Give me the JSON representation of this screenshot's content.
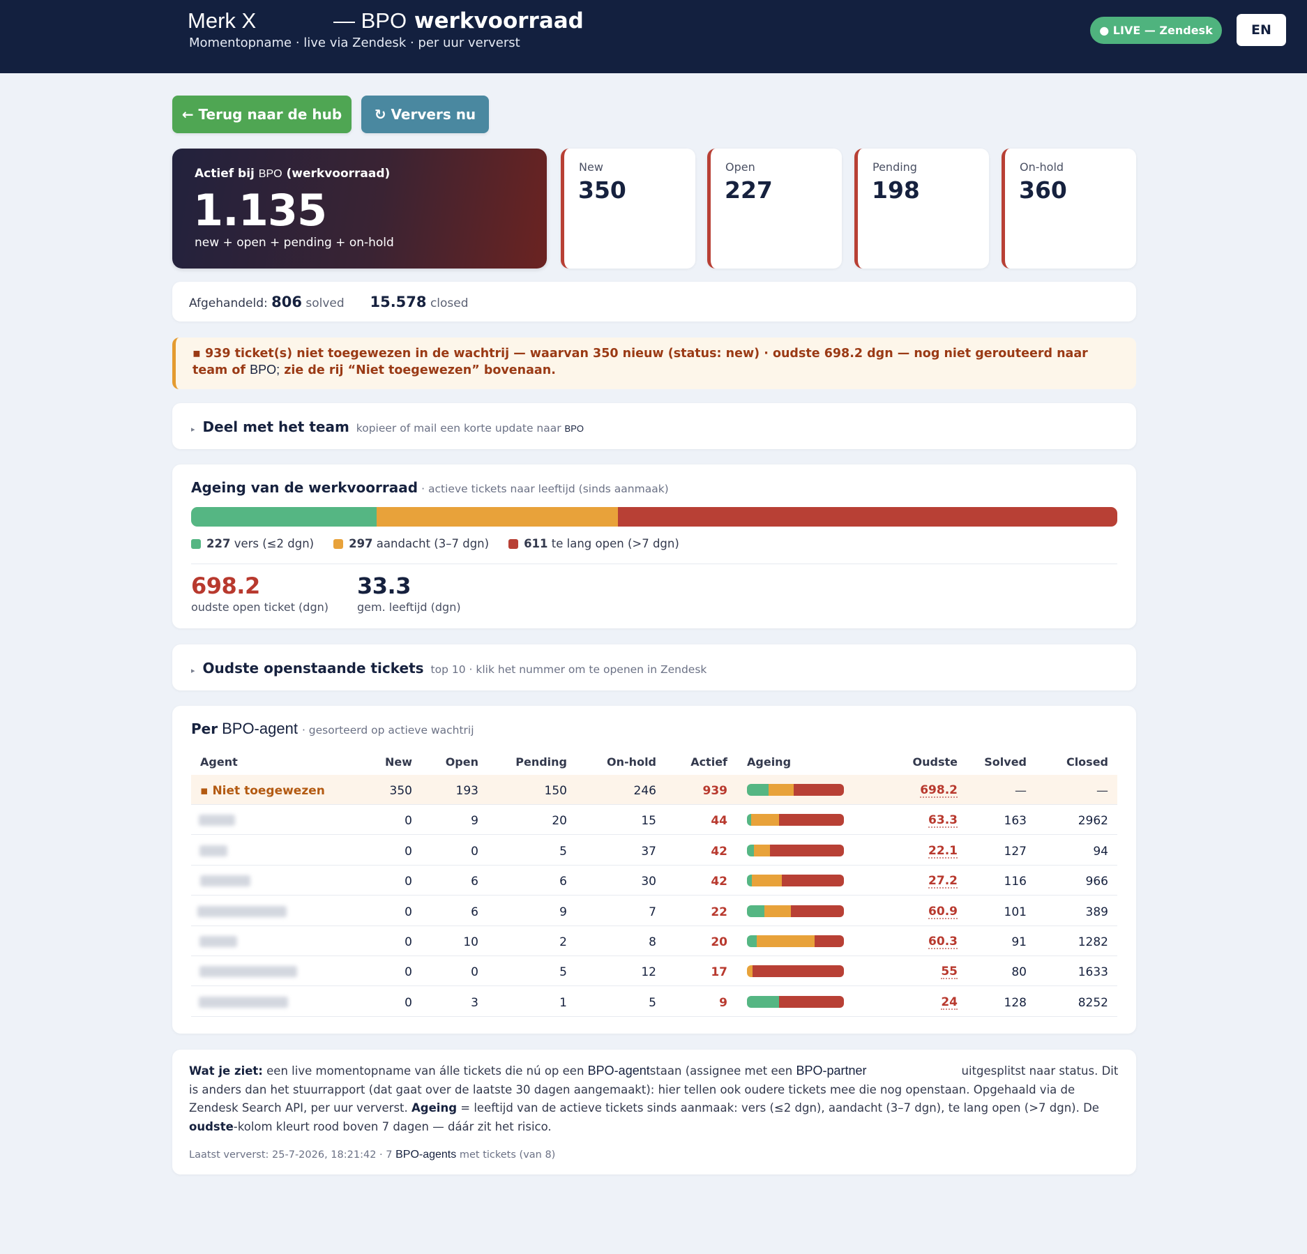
{
  "header": {
    "brand": "Merk X",
    "title_sep": "— BPO",
    "title_main": "werkvoorraad",
    "subtitle": "Momentopname · live via Zendesk · per uur ververst",
    "live_badge": "● LIVE — Zendesk",
    "lang_button": "EN"
  },
  "actions": {
    "back_label": "← Terug naar de hub",
    "refresh_label": "↻ Ververs nu"
  },
  "hero": {
    "label_pre": "Actief bij",
    "label_bpo": "BPO",
    "label_post": "(werkvoorraad)",
    "value": "1.135",
    "formula": "new + open + pending + on-hold"
  },
  "status_cards": [
    {
      "label": "New",
      "value": "350"
    },
    {
      "label": "Open",
      "value": "227"
    },
    {
      "label": "Pending",
      "value": "198"
    },
    {
      "label": "On-hold",
      "value": "360"
    }
  ],
  "resolved": {
    "label": "Afgehandeld:",
    "solved_value": "806",
    "solved_label": "solved",
    "closed_value": "15.578",
    "closed_label": "closed"
  },
  "alert": {
    "bullet": "▪",
    "count": "939",
    "t1": "ticket(s) niet toegewezen in de wachtrij — waarvan",
    "new_count": "350",
    "t2": "nieuw (status: new) · oudste",
    "oldest": "698.2",
    "t3": "dgn — nog niet gerouteerd naar team of",
    "bpo": "BPO;",
    "t4": "zie de rij “Niet toegewezen” bovenaan."
  },
  "share": {
    "caret": "▸",
    "title": "Deel met het team",
    "subtitle": "kopieer of mail een korte update naar",
    "bpo": "BPO"
  },
  "ageing": {
    "title": "Ageing van de werkvoorraad",
    "subtitle": "· actieve tickets naar leeftijd (sinds aanmaak)",
    "segments": [
      {
        "count": "227",
        "label": "vers (≤2 dgn)",
        "share": 0.2
      },
      {
        "count": "297",
        "label": "aandacht (3–7 dgn)",
        "share": 0.261
      },
      {
        "count": "611",
        "label": "te lang open (>7 dgn)",
        "share": 0.539
      }
    ],
    "oldest_value": "698.2",
    "oldest_label": "oudste open ticket (dgn)",
    "avg_value": "33.3",
    "avg_label": "gem. leeftijd (dgn)"
  },
  "oldest_tickets": {
    "caret": "▸",
    "title": "Oudste openstaande tickets",
    "subtitle": "top 10 · klik het nummer om te openen in Zendesk"
  },
  "agents": {
    "title_pre": "Per",
    "title_token": "BPO-agent",
    "subtitle": "· gesorteerd op actieve wachtrij",
    "columns": [
      "Agent",
      "New",
      "Open",
      "Pending",
      "On-hold",
      "Actief",
      "Ageing",
      "Oudste",
      "Solved",
      "Closed"
    ],
    "rows": [
      {
        "name": "▪ Niet toegewezen",
        "new": "350",
        "open": "193",
        "pending": "150",
        "onhold": "246",
        "active": "939",
        "ageing": [
          0.22,
          0.26,
          0.52
        ],
        "oldest": "698.2",
        "solved": "—",
        "closed": "—"
      },
      {
        "new": "0",
        "open": "9",
        "pending": "20",
        "onhold": "15",
        "active": "44",
        "ageing": [
          0.04,
          0.29,
          0.67
        ],
        "oldest": "63.3",
        "solved": "163",
        "closed": "2962"
      },
      {
        "new": "0",
        "open": "0",
        "pending": "5",
        "onhold": "37",
        "active": "42",
        "ageing": [
          0.07,
          0.17,
          0.76
        ],
        "oldest": "22.1",
        "solved": "127",
        "closed": "94"
      },
      {
        "new": "0",
        "open": "6",
        "pending": "6",
        "onhold": "30",
        "active": "42",
        "ageing": [
          0.05,
          0.31,
          0.64
        ],
        "oldest": "27.2",
        "solved": "116",
        "closed": "966"
      },
      {
        "new": "0",
        "open": "6",
        "pending": "9",
        "onhold": "7",
        "active": "22",
        "ageing": [
          0.18,
          0.27,
          0.55
        ],
        "oldest": "60.9",
        "solved": "101",
        "closed": "389"
      },
      {
        "new": "0",
        "open": "10",
        "pending": "2",
        "onhold": "8",
        "active": "20",
        "ageing": [
          0.1,
          0.6,
          0.3
        ],
        "oldest": "60.3",
        "solved": "91",
        "closed": "1282"
      },
      {
        "new": "0",
        "open": "0",
        "pending": "5",
        "onhold": "12",
        "active": "17",
        "ageing": [
          0.0,
          0.06,
          0.94
        ],
        "oldest": "55",
        "solved": "80",
        "closed": "1633"
      },
      {
        "new": "0",
        "open": "3",
        "pending": "1",
        "onhold": "5",
        "active": "9",
        "ageing": [
          0.33,
          0.0,
          0.67
        ],
        "oldest": "24",
        "solved": "128",
        "closed": "8252"
      }
    ]
  },
  "footnote": {
    "bold1": "Wat je ziet:",
    "t1": "een live momentopname van álle tickets die nú op een",
    "tok1": "BPO-agent",
    "t2": "staan (assignee met een",
    "tok2": "BPO-partner",
    "t3": "uitgesplitst naar status. Dit is anders dan het stuurrapport (dat gaat over de laatste 30 dagen aangemaakt): hier tellen ook oudere tickets mee die nog openstaan. Opgehaald via de Zendesk Search API, per uur ververst.",
    "bold2": "Ageing",
    "t4": "= leeftijd van de actieve tickets sinds aanmaak: vers (≤2 dgn), aandacht (3–7 dgn), te lang open (>7 dgn). De",
    "bold3": "oudste",
    "t5": "-kolom kleurt rood boven 7 dagen — dáár zit het risico.",
    "meta_pre": "Laatst ververst: 25-7-2026, 18:21:42 · 7",
    "meta_tok": "BPO-agents",
    "meta_post": "met tickets (van 8)"
  },
  "colors": {
    "fresh": "#55b683",
    "attention": "#e8a23a",
    "late": "#b84035"
  }
}
